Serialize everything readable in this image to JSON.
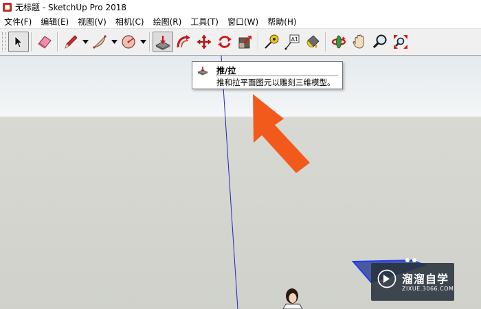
{
  "window": {
    "title": "无标题 - SketchUp Pro 2018"
  },
  "menu": [
    {
      "label": "文件(F)"
    },
    {
      "label": "编辑(E)"
    },
    {
      "label": "视图(V)"
    },
    {
      "label": "相机(C)"
    },
    {
      "label": "绘图(R)"
    },
    {
      "label": "工具(T)"
    },
    {
      "label": "窗口(W)"
    },
    {
      "label": "帮助(H)"
    }
  ],
  "toolbar": {
    "tools": [
      "select-icon",
      "eraser-icon",
      "pencil-icon",
      "arc-icon",
      "circle-polygon-icon",
      "push-pull-icon",
      "follow-me-icon",
      "move-icon",
      "rotate-icon",
      "scale-icon",
      "tape-measure-icon",
      "text-icon",
      "paint-bucket-icon",
      "orbit-icon",
      "pan-icon",
      "zoom-icon",
      "zoom-extents-icon"
    ],
    "active_tool": "push-pull-icon"
  },
  "tooltip": {
    "title": "推/拉",
    "description": "推和拉平面图元以雕刻三维模型。"
  },
  "watermark": {
    "text": "溜溜自学",
    "subtext": "ZIXUE.3066.COM"
  },
  "colors": {
    "annotation_arrow": "#f25a1c",
    "blue_axis": "#2323c8",
    "selection_blue": "#1e3cff"
  }
}
